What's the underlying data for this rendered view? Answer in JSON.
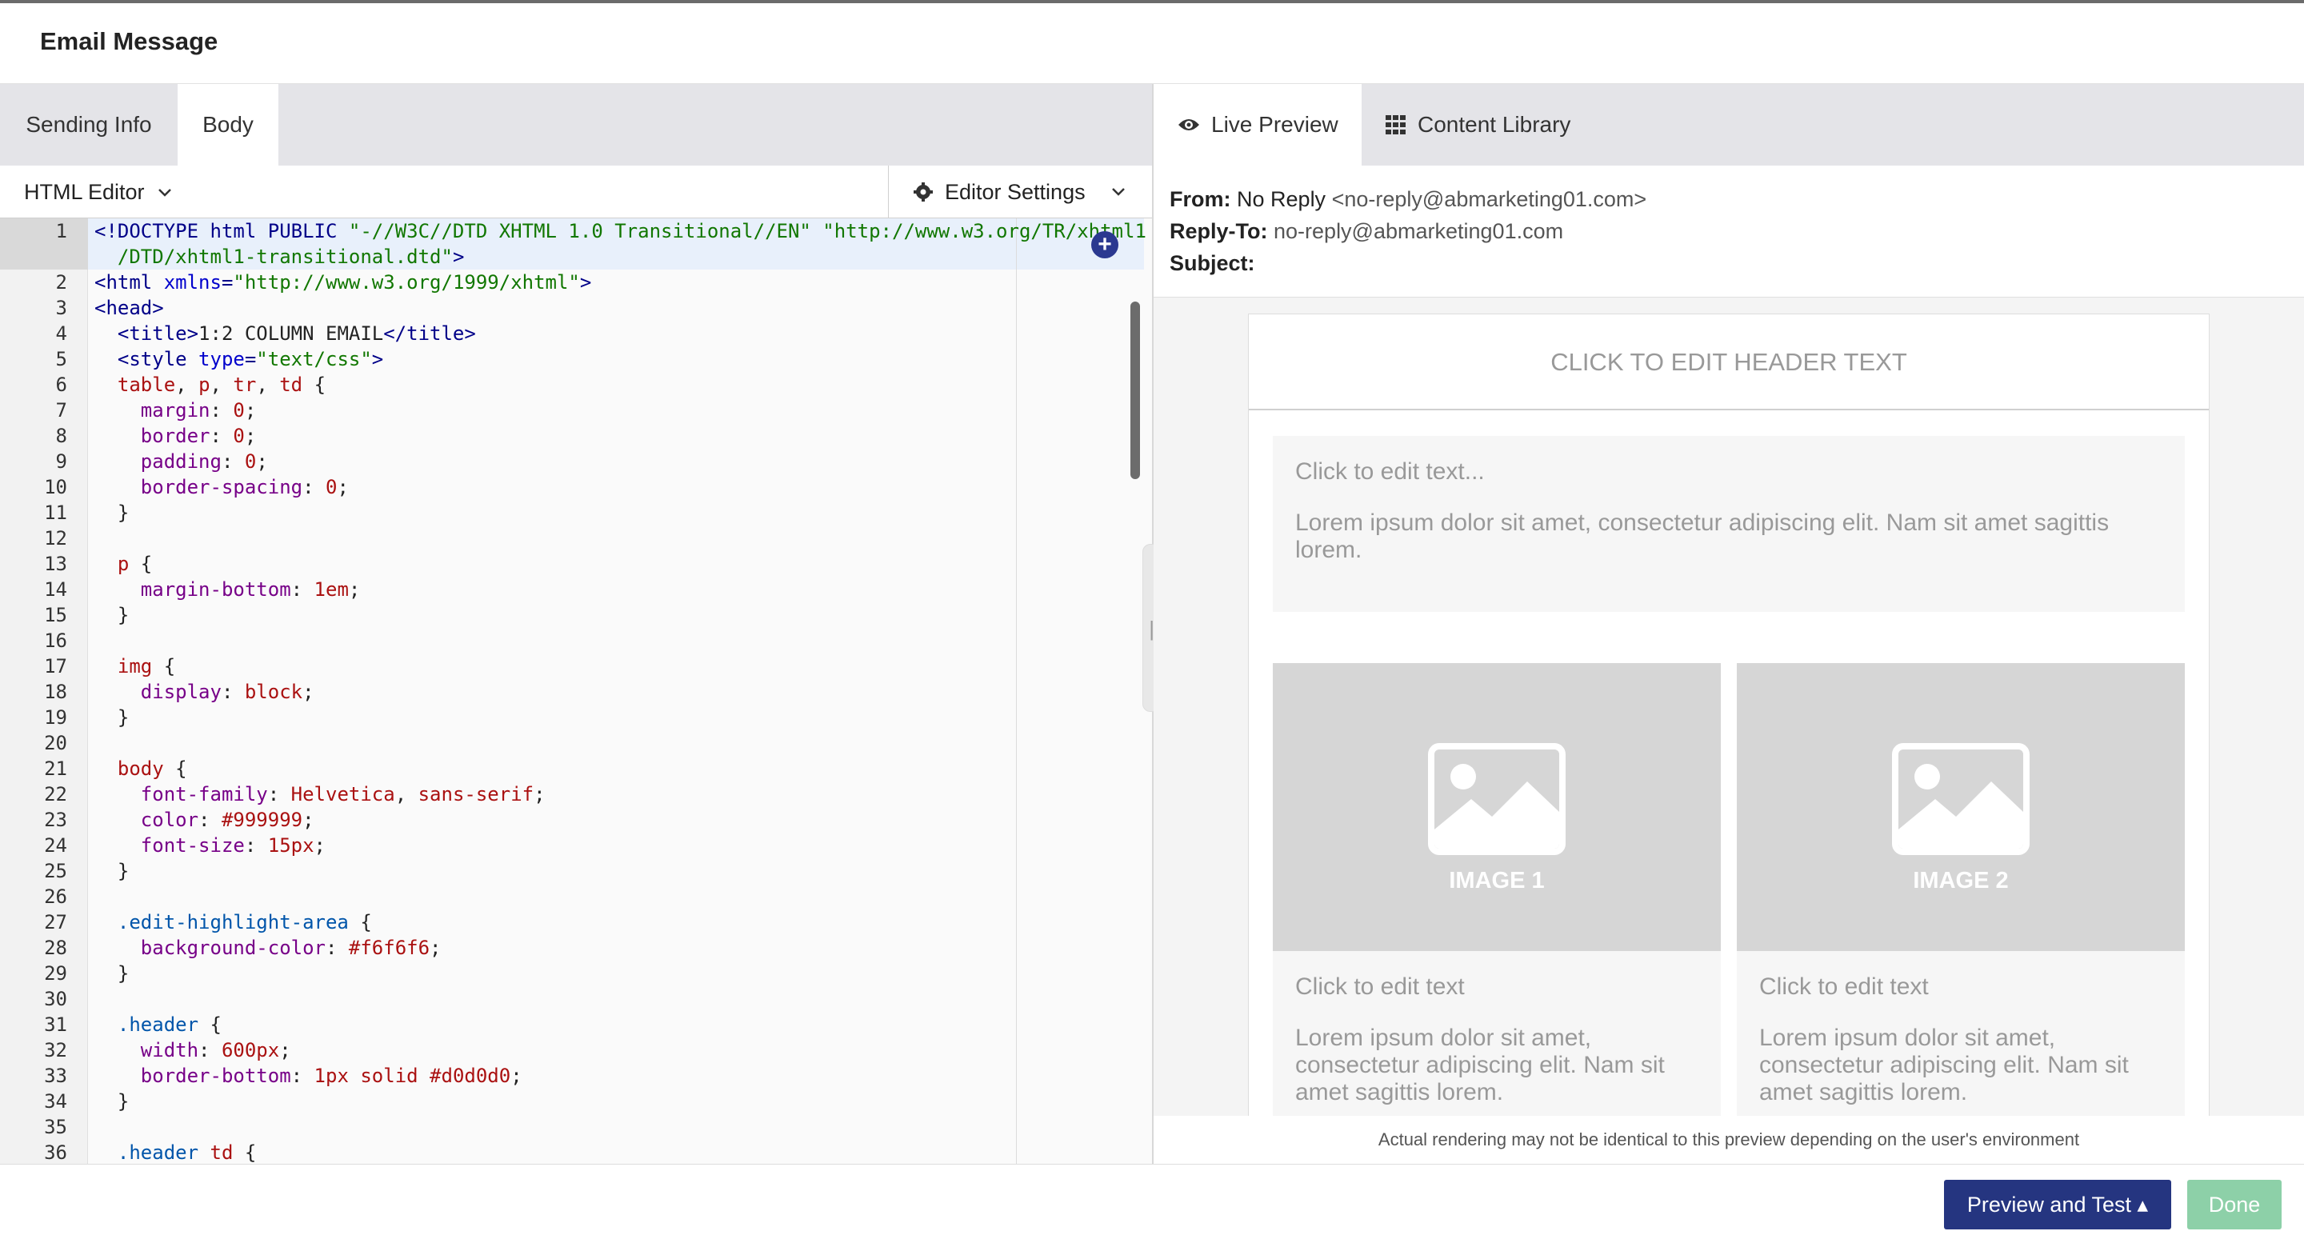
{
  "window": {
    "title": "Email Message"
  },
  "left_tabs": [
    {
      "label": "Sending Info",
      "active": false
    },
    {
      "label": "Body",
      "active": true
    }
  ],
  "editor_bar": {
    "mode_label": "HTML Editor",
    "settings_label": "Editor Settings"
  },
  "code_lines": [
    {
      "n": "1",
      "parts": [
        [
          "k",
          "<!DOCTYPE html PUBLIC "
        ],
        [
          "t",
          "\"-//W3C//DTD XHTML 1.0 Transitional//EN\" \"http://www.w3.org/TR/xhtml1"
        ]
      ]
    },
    {
      "n": "",
      "parts": [
        [
          "t",
          "  /DTD/xhtml1-transitional.dtd\""
        ],
        [
          "k",
          ">"
        ]
      ]
    },
    {
      "n": "2",
      "parts": [
        [
          "k",
          "<html "
        ],
        [
          "a",
          "xmlns"
        ],
        [
          "k",
          "="
        ],
        [
          "t",
          "\"http://www.w3.org/1999/xhtml\""
        ],
        [
          "k",
          ">"
        ]
      ]
    },
    {
      "n": "3",
      "parts": [
        [
          "k",
          "<head>"
        ]
      ]
    },
    {
      "n": "4",
      "parts": [
        [
          "k",
          "  <title>"
        ],
        [
          "x",
          "1:2 COLUMN EMAIL"
        ],
        [
          "k",
          "</title>"
        ]
      ]
    },
    {
      "n": "5",
      "parts": [
        [
          "k",
          "  <style "
        ],
        [
          "a",
          "type"
        ],
        [
          "k",
          "="
        ],
        [
          "t",
          "\"text/css\""
        ],
        [
          "k",
          ">"
        ]
      ]
    },
    {
      "n": "6",
      "parts": [
        [
          "x",
          "  "
        ],
        [
          "s",
          "table"
        ],
        [
          "x",
          ", "
        ],
        [
          "s",
          "p"
        ],
        [
          "x",
          ", "
        ],
        [
          "s",
          "tr"
        ],
        [
          "x",
          ", "
        ],
        [
          "s",
          "td"
        ],
        [
          "x",
          " {"
        ]
      ]
    },
    {
      "n": "7",
      "parts": [
        [
          "p",
          "    margin"
        ],
        [
          "x",
          ": "
        ],
        [
          "s",
          "0"
        ],
        [
          "x",
          ";"
        ]
      ]
    },
    {
      "n": "8",
      "parts": [
        [
          "p",
          "    border"
        ],
        [
          "x",
          ": "
        ],
        [
          "s",
          "0"
        ],
        [
          "x",
          ";"
        ]
      ]
    },
    {
      "n": "9",
      "parts": [
        [
          "p",
          "    padding"
        ],
        [
          "x",
          ": "
        ],
        [
          "s",
          "0"
        ],
        [
          "x",
          ";"
        ]
      ]
    },
    {
      "n": "10",
      "parts": [
        [
          "p",
          "    border-spacing"
        ],
        [
          "x",
          ": "
        ],
        [
          "s",
          "0"
        ],
        [
          "x",
          ";"
        ]
      ]
    },
    {
      "n": "11",
      "parts": [
        [
          "x",
          "  }"
        ]
      ]
    },
    {
      "n": "12",
      "parts": [
        [
          "x",
          ""
        ]
      ]
    },
    {
      "n": "13",
      "parts": [
        [
          "x",
          "  "
        ],
        [
          "s",
          "p"
        ],
        [
          "x",
          " {"
        ]
      ]
    },
    {
      "n": "14",
      "parts": [
        [
          "p",
          "    margin-bottom"
        ],
        [
          "x",
          ": "
        ],
        [
          "s",
          "1em"
        ],
        [
          "x",
          ";"
        ]
      ]
    },
    {
      "n": "15",
      "parts": [
        [
          "x",
          "  }"
        ]
      ]
    },
    {
      "n": "16",
      "parts": [
        [
          "x",
          ""
        ]
      ]
    },
    {
      "n": "17",
      "parts": [
        [
          "x",
          "  "
        ],
        [
          "s",
          "img"
        ],
        [
          "x",
          " {"
        ]
      ]
    },
    {
      "n": "18",
      "parts": [
        [
          "p",
          "    display"
        ],
        [
          "x",
          ": "
        ],
        [
          "s",
          "block"
        ],
        [
          "x",
          ";"
        ]
      ]
    },
    {
      "n": "19",
      "parts": [
        [
          "x",
          "  }"
        ]
      ]
    },
    {
      "n": "20",
      "parts": [
        [
          "x",
          ""
        ]
      ]
    },
    {
      "n": "21",
      "parts": [
        [
          "x",
          "  "
        ],
        [
          "s",
          "body"
        ],
        [
          "x",
          " {"
        ]
      ]
    },
    {
      "n": "22",
      "parts": [
        [
          "p",
          "    font-family"
        ],
        [
          "x",
          ": "
        ],
        [
          "s",
          "Helvetica"
        ],
        [
          "x",
          ", "
        ],
        [
          "s",
          "sans-serif"
        ],
        [
          "x",
          ";"
        ]
      ]
    },
    {
      "n": "23",
      "parts": [
        [
          "p",
          "    color"
        ],
        [
          "x",
          ": "
        ],
        [
          "s",
          "#999999"
        ],
        [
          "x",
          ";"
        ]
      ]
    },
    {
      "n": "24",
      "parts": [
        [
          "p",
          "    font-size"
        ],
        [
          "x",
          ": "
        ],
        [
          "s",
          "15px"
        ],
        [
          "x",
          ";"
        ]
      ]
    },
    {
      "n": "25",
      "parts": [
        [
          "x",
          "  }"
        ]
      ]
    },
    {
      "n": "26",
      "parts": [
        [
          "x",
          ""
        ]
      ]
    },
    {
      "n": "27",
      "parts": [
        [
          "pn",
          "  .edit-highlight-area"
        ],
        [
          "x",
          " {"
        ]
      ]
    },
    {
      "n": "28",
      "parts": [
        [
          "p",
          "    background-color"
        ],
        [
          "x",
          ": "
        ],
        [
          "s",
          "#f6f6f6"
        ],
        [
          "x",
          ";"
        ]
      ]
    },
    {
      "n": "29",
      "parts": [
        [
          "x",
          "  }"
        ]
      ]
    },
    {
      "n": "30",
      "parts": [
        [
          "x",
          ""
        ]
      ]
    },
    {
      "n": "31",
      "parts": [
        [
          "pn",
          "  .header"
        ],
        [
          "x",
          " {"
        ]
      ]
    },
    {
      "n": "32",
      "parts": [
        [
          "p",
          "    width"
        ],
        [
          "x",
          ": "
        ],
        [
          "s",
          "600px"
        ],
        [
          "x",
          ";"
        ]
      ]
    },
    {
      "n": "33",
      "parts": [
        [
          "p",
          "    border-bottom"
        ],
        [
          "x",
          ": "
        ],
        [
          "s",
          "1px solid #d0d0d0"
        ],
        [
          "x",
          ";"
        ]
      ]
    },
    {
      "n": "34",
      "parts": [
        [
          "x",
          "  }"
        ]
      ]
    },
    {
      "n": "35",
      "parts": [
        [
          "x",
          ""
        ]
      ]
    },
    {
      "n": "36",
      "parts": [
        [
          "pn",
          "  .header "
        ],
        [
          "s",
          "td"
        ],
        [
          "x",
          " {"
        ]
      ]
    }
  ],
  "right_tabs": [
    {
      "label": "Live Preview",
      "icon": "eye-icon",
      "active": true
    },
    {
      "label": "Content Library",
      "icon": "grid-icon",
      "active": false
    }
  ],
  "headers": {
    "from_label": "From:",
    "from_name": "No Reply",
    "from_email": "<no-reply@abmarketing01.com>",
    "reply_to_label": "Reply-To:",
    "reply_to_value": "no-reply@abmarketing01.com",
    "subject_label": "Subject:"
  },
  "preview": {
    "header_text": "CLICK TO EDIT HEADER TEXT",
    "text_block_title": "Click to edit text...",
    "text_block_body": "Lorem ipsum dolor sit amet, consectetur adipiscing elit. Nam sit amet sagittis lorem.",
    "image1_label": "IMAGE 1",
    "image2_label": "IMAGE 2",
    "col1_title": "Click to edit text",
    "col1_body": "Lorem ipsum dolor sit amet, consectetur adipiscing elit. Nam sit amet sagittis lorem.",
    "col2_title": "Click to edit text",
    "col2_body": "Lorem ipsum dolor sit amet, consectetur adipiscing elit. Nam sit amet sagittis lorem.",
    "disclaimer": "Actual rendering may not be identical to this preview depending on the user's environment"
  },
  "footer": {
    "preview_button": "Preview and Test ▴",
    "done_button": "Done"
  }
}
